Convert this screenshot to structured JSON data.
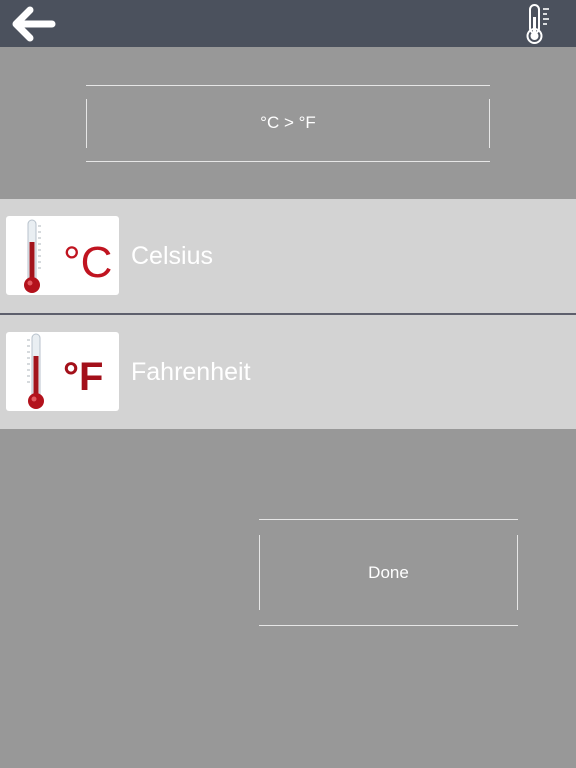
{
  "topbar": {
    "back_icon": "arrow-left-icon",
    "thermometer_icon": "thermometer-icon"
  },
  "converter": {
    "label": "°C > °F"
  },
  "units": [
    {
      "name": "Celsius",
      "symbol": "°C",
      "icon": "celsius-thermometer-icon"
    },
    {
      "name": "Fahrenheit",
      "symbol": "°F",
      "icon": "fahrenheit-thermometer-icon"
    }
  ],
  "done": {
    "label": "Done"
  },
  "colors": {
    "topbar": "#4b515d",
    "background": "#989898",
    "row": "#d3d3d3",
    "thermo_red": "#a3141c"
  }
}
